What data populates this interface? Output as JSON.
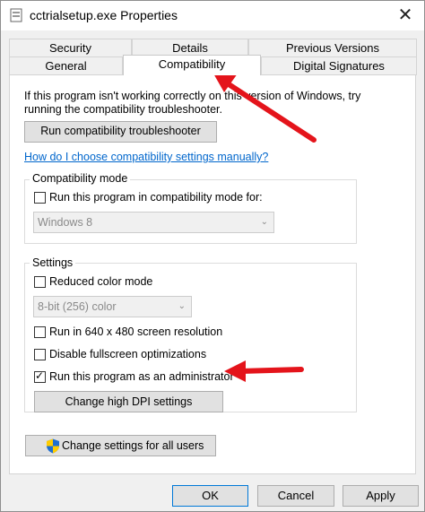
{
  "window": {
    "title": "cctrialsetup.exe Properties",
    "close_glyph": "✕"
  },
  "tabs": {
    "row1": [
      {
        "label": "Security"
      },
      {
        "label": "Details"
      },
      {
        "label": "Previous Versions"
      }
    ],
    "row2": [
      {
        "label": "General"
      },
      {
        "label": "Compatibility",
        "active": true
      },
      {
        "label": "Digital Signatures"
      }
    ]
  },
  "compat": {
    "intro_line1": "If this program isn't working correctly on this version of Windows, try",
    "intro_line2": "running the compatibility troubleshooter.",
    "troubleshooter_button": "Run compatibility troubleshooter",
    "manual_link": "How do I choose compatibility settings manually?",
    "mode_group": {
      "label": "Compatibility mode",
      "checkbox_label": "Run this program in compatibility mode for:",
      "checked": false,
      "select_value": "Windows 8"
    },
    "settings_group": {
      "label": "Settings",
      "reduced_color": {
        "label": "Reduced color mode",
        "checked": false
      },
      "color_select_value": "8-bit (256) color",
      "res640": {
        "label": "Run in 640 x 480 screen resolution",
        "checked": false
      },
      "fullscreen": {
        "label": "Disable fullscreen optimizations",
        "checked": false
      },
      "admin": {
        "label": "Run this program as an administrator",
        "checked": true
      },
      "dpi_button": "Change high DPI settings"
    },
    "all_users_button": "Change settings for all users"
  },
  "footer": {
    "ok": "OK",
    "cancel": "Cancel",
    "apply": "Apply"
  },
  "icons": {
    "app": "file-icon",
    "shield": "uac-shield-icon",
    "annotation": "red-arrow-icon"
  },
  "colors": {
    "accent": "#0078d7",
    "link": "#0066cc",
    "annotation": "#e4141b"
  }
}
